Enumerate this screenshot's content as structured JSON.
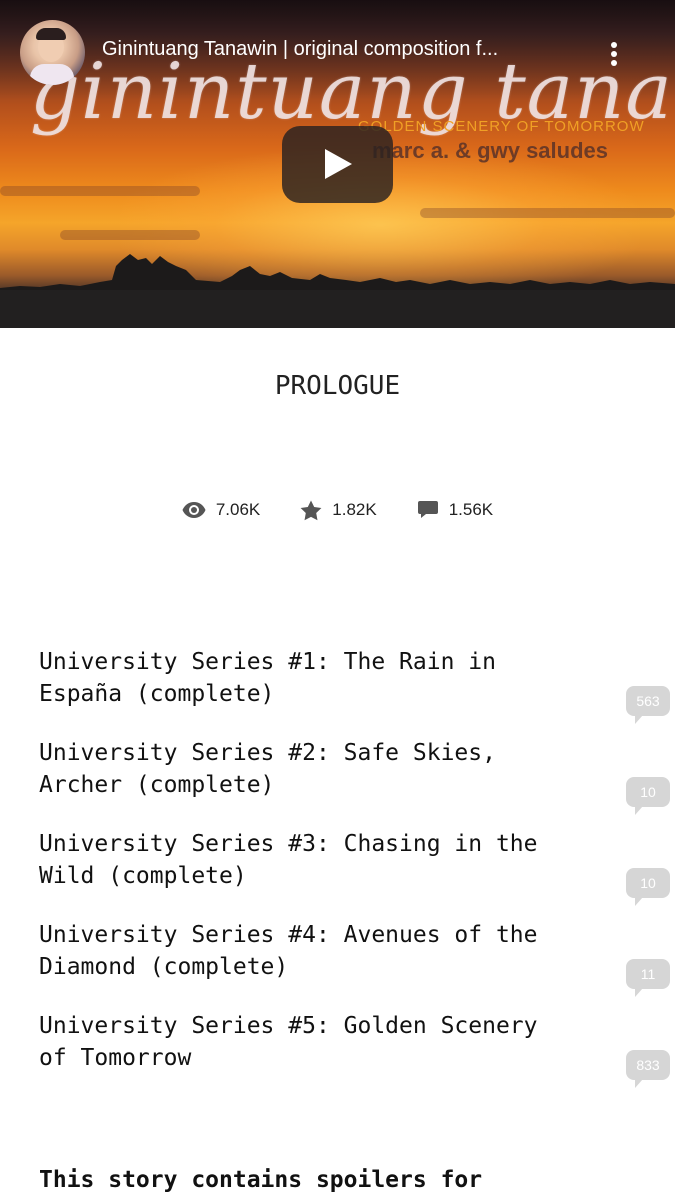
{
  "video": {
    "title": "Ginintuang Tanawin | original composition f...",
    "overlay_script": "ginintuang tanawin",
    "overlay_subtitle": "GOLDEN SCENERY OF TOMORROW",
    "overlay_credit": "marc a. & gwy saludes",
    "play_icon": "play-icon",
    "menu_icon": "more-vert-icon"
  },
  "chapter": {
    "title": "PROLOGUE",
    "stats": {
      "reads": "7.06K",
      "votes": "1.82K",
      "comments": "1.56K"
    }
  },
  "series": [
    {
      "line1": "University Series #1: The Rain in",
      "line2": "España (complete)",
      "comments": "563"
    },
    {
      "line1": "University Series #2: Safe Skies,",
      "line2": "Archer (complete)",
      "comments": "10"
    },
    {
      "line1": "University Series #3: Chasing in the",
      "line2": "Wild (complete)",
      "comments": "10"
    },
    {
      "line1": "University Series #4: Avenues of the",
      "line2": "Diamond (complete)",
      "comments": "11"
    },
    {
      "line1": "University Series #5: Golden Scenery",
      "line2": "of Tomorrow",
      "comments": "833"
    }
  ],
  "spoiler_text": "This story contains spoilers for",
  "colors": {
    "text": "#111111",
    "bubble": "#d6d6d6",
    "stat_icon": "#555555"
  }
}
